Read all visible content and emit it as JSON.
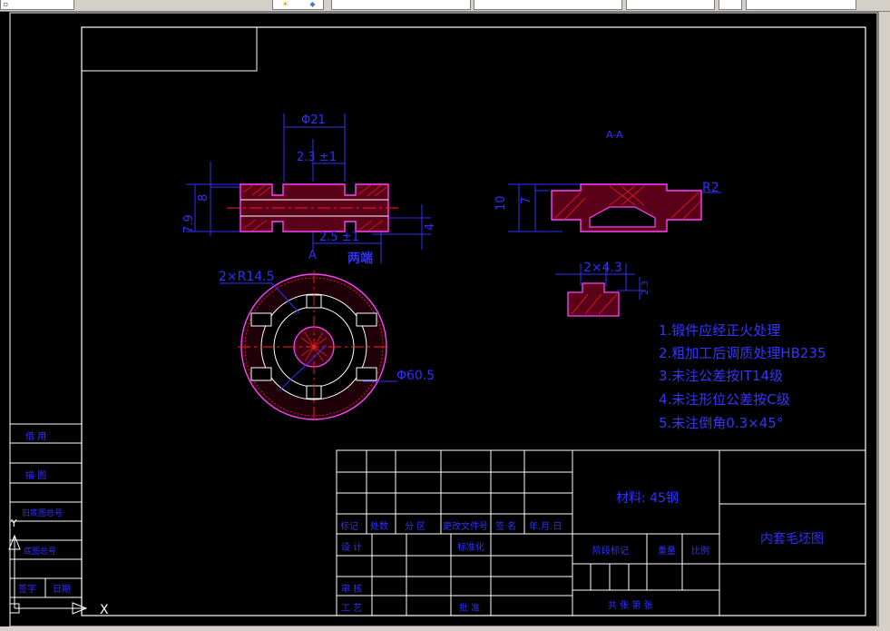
{
  "toolbar": {
    "icons": [
      "toolbar-button-icon",
      "layer-icon",
      "layer-dropdown-icon",
      "linetype-dropdown-icon",
      "lineweight-dropdown-icon",
      "color-dropdown-icon"
    ]
  },
  "colors": {
    "background": "#000000",
    "frame": "#ffffff",
    "dimension": "#3030ff",
    "outline": "#ff40ff",
    "hatch": "#ff2020",
    "centerline": "#ff2020"
  },
  "drawing": {
    "front_view": {
      "dim_top": "Φ21",
      "dim_tol_upper": "2.3 ±1",
      "dim_tol_lower": "2.5 ±1",
      "dim_h1": "8",
      "dim_h2": "7.9",
      "dim_h3": "4",
      "section_mark": "A",
      "end_label": "两端"
    },
    "section_view": {
      "title": "A-A",
      "dim_10": "10",
      "dim_7": "7",
      "radius": "R2"
    },
    "detail_view": {
      "width_dim": "2×4.3",
      "depth_dim": "2.3"
    },
    "top_view": {
      "radius_dim": "2×R14.5",
      "diameter_dim": "Φ60.5"
    },
    "notes": [
      "1.锻件应经正火处理",
      "2.粗加工后调质处理HB235",
      "3.未注公差按IT14级",
      "4.未注形位公差按C级",
      "5.未注倒角0.3×45°"
    ]
  },
  "title_block": {
    "material": "材料: 45钢",
    "drawing_name": "内套毛坯图",
    "row_labels": [
      "标记",
      "处数",
      "分  区",
      "更改文件号",
      "签  名",
      "年.月.日"
    ],
    "design": "设  计",
    "standardize": "标准化",
    "review": "审  核",
    "process": "工  艺",
    "approve": "批  准",
    "stage_mark": "阶段标记",
    "weight": "重量",
    "scale": "比例",
    "sheets": "共      张  第      张"
  },
  "left_strip": {
    "labels": [
      "借  用",
      "描  图",
      "旧底图总号",
      "底图总号",
      "签字",
      "日期"
    ]
  },
  "ucs": {
    "y_label": "Y",
    "x_label": "X"
  }
}
